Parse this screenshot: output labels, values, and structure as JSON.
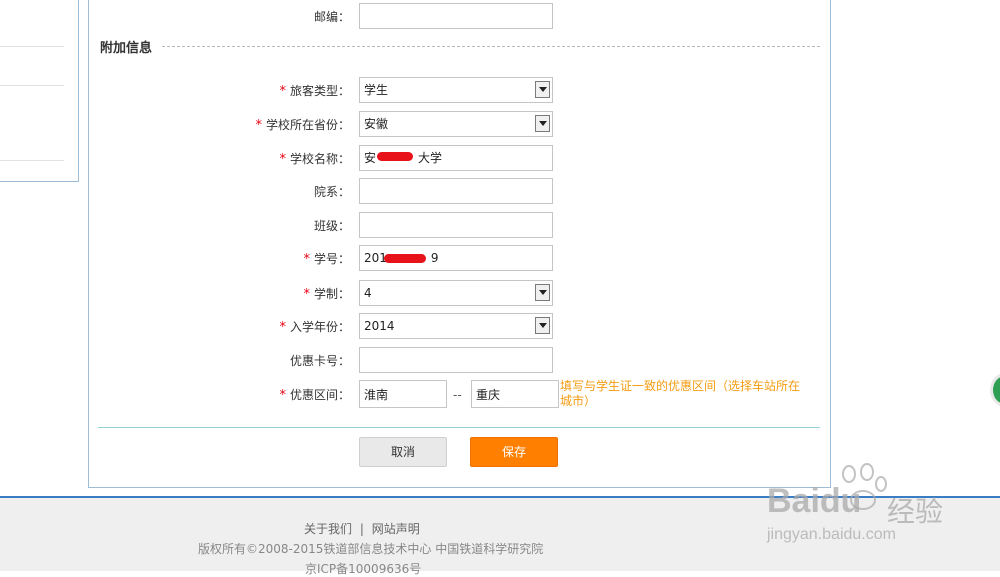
{
  "section_title": "附加信息",
  "fields": {
    "postcode": {
      "label": "邮编：",
      "value": ""
    },
    "passenger_type": {
      "label": "旅客类型：",
      "value": "学生"
    },
    "school_province": {
      "label": "学校所在省份：",
      "value": "安徽"
    },
    "school_name": {
      "label": "学校名称：",
      "value_prefix": "安",
      "value_suffix": "大学"
    },
    "department": {
      "label": "院系：",
      "value": ""
    },
    "class": {
      "label": "班级：",
      "value": ""
    },
    "student_id": {
      "label": "学号：",
      "value_prefix": "201",
      "value_suffix": "9"
    },
    "schooling_years": {
      "label": "学制：",
      "value": "4"
    },
    "enroll_year": {
      "label": "入学年份：",
      "value": "2014"
    },
    "discount_card": {
      "label": "优惠卡号：",
      "value": ""
    },
    "discount_range": {
      "label": "优惠区间：",
      "from": "淮南",
      "separator": "--",
      "to": "重庆"
    }
  },
  "required_mark": "*",
  "hint": "填写与学生证一致的优惠区间（选择车站所在城市）",
  "buttons": {
    "cancel": "取消",
    "save": "保存"
  },
  "footer": {
    "about": "关于我们",
    "divider": "|",
    "statement": "网站声明",
    "copyright": "版权所有©2008-2015铁道部信息技术中心  中国铁道科学研究院",
    "icp": "京ICP备10009636号"
  },
  "watermark": {
    "brand": "Baidu",
    "brand_cn": "经验",
    "url": "jingyan.baidu.com"
  },
  "colors": {
    "required": "#e60012",
    "save_button": "#ff8000",
    "hint": "#f39c12",
    "footer_border": "#3b7dc4"
  }
}
